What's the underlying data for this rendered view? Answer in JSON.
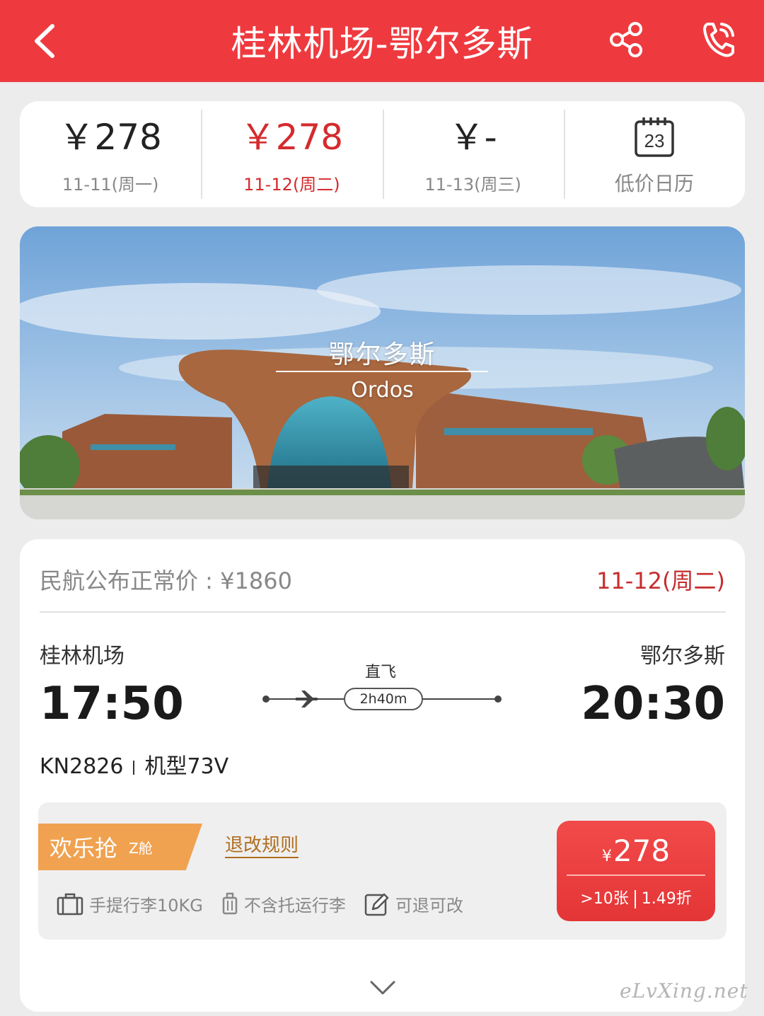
{
  "header": {
    "title": "桂林机场-鄂尔多斯",
    "back_icon": "chevron-left-icon",
    "share_icon": "share-icon",
    "phone_icon": "phone-icon",
    "accent_color": "#ee3a3f"
  },
  "dates": [
    {
      "price": "￥278",
      "label": "11-11(周一)",
      "active": false
    },
    {
      "price": "￥278",
      "label": "11-12(周二)",
      "active": true
    },
    {
      "price": "￥-",
      "label": "11-13(周三)",
      "active": false
    }
  ],
  "calendar": {
    "day": "23",
    "label": "低价日历"
  },
  "banner": {
    "city_cn": "鄂尔多斯",
    "city_en": "Ordos"
  },
  "flight": {
    "std_price": "民航公布正常价 : ¥1860",
    "date": "11-12(周二)",
    "dep_airport": "桂林机场",
    "arr_airport": "鄂尔多斯",
    "dep_time": "17:50",
    "arr_time": "20:30",
    "direct_label": "直飞",
    "duration": "2h40m",
    "flight_no": "KN2826",
    "aircraft": "机型73V"
  },
  "fare": {
    "tag_main": "欢乐抢",
    "tag_sub": "Z舱",
    "rules_link": "退改规则",
    "features": [
      {
        "icon": "carry-on-bag-icon",
        "label": "手提行李10KG"
      },
      {
        "icon": "luggage-icon",
        "label": "不含托运行李"
      },
      {
        "icon": "edit-icon",
        "label": "可退可改"
      }
    ],
    "price_symbol": "¥",
    "price": "278",
    "seats": ">10张",
    "discount": "1.49折"
  },
  "watermark": "eLvXing.net"
}
